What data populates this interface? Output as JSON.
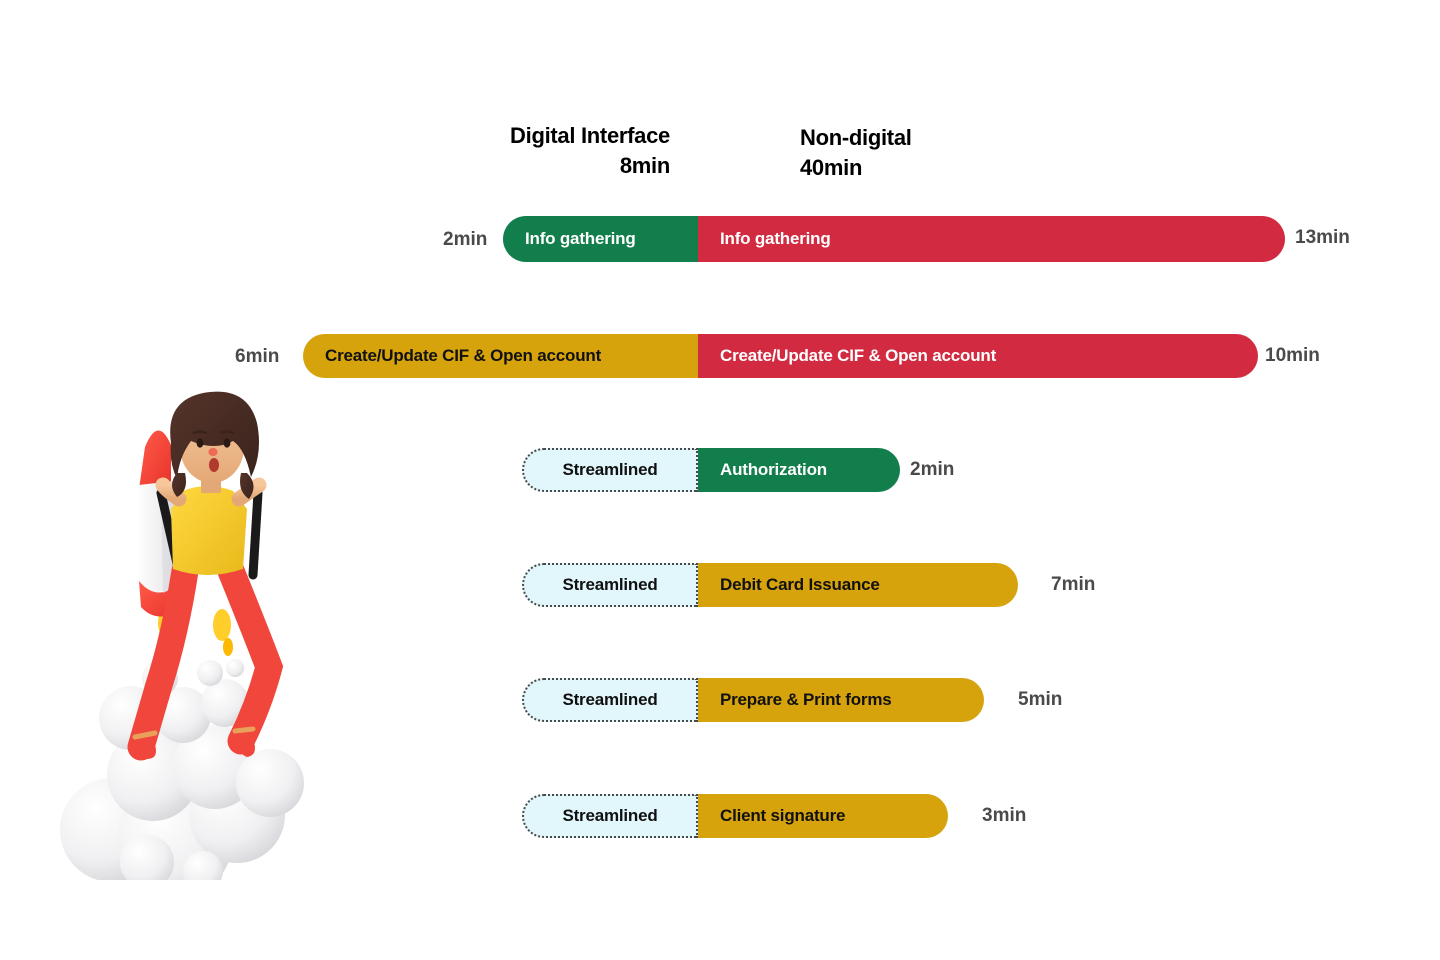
{
  "headers": {
    "digital": "Digital Interface\n8min",
    "non_digital": "Non-digital\n40min"
  },
  "colors": {
    "green": "#117E4B",
    "red": "#D22B41",
    "gold": "#D6A30D",
    "streamlined_bg": "#E2F7FB",
    "label_text": "#4a4a4a",
    "background": "#FFFFFF"
  },
  "rows": [
    {
      "id": "info-gathering",
      "left_label": "2min",
      "right_label": "13min",
      "digital_label": "Info gathering",
      "nondigital_label": "Info gathering",
      "digital_minutes": 2,
      "nondigital_minutes": 13
    },
    {
      "id": "create-update-cif",
      "left_label": "6min",
      "right_label": "10min",
      "digital_label": "Create/Update CIF & Open account",
      "nondigital_label": "Create/Update CIF & Open account",
      "digital_minutes": 6,
      "nondigital_minutes": 10
    },
    {
      "id": "authorization",
      "pill_label": "Streamlined",
      "task_label": "Authorization",
      "right_label": "2min",
      "nondigital_minutes": 2
    },
    {
      "id": "debit-card-issuance",
      "pill_label": "Streamlined",
      "task_label": "Debit Card Issuance",
      "right_label": "7min",
      "nondigital_minutes": 7
    },
    {
      "id": "prepare-print-forms",
      "pill_label": "Streamlined",
      "task_label": "Prepare & Print forms",
      "right_label": "5min",
      "nondigital_minutes": 5
    },
    {
      "id": "client-signature",
      "pill_label": "Streamlined",
      "task_label": "Client signature",
      "right_label": "3min",
      "nondigital_minutes": 3
    }
  ],
  "illustration": {
    "name": "woman-riding-rocket-illustration"
  },
  "chart_data": {
    "type": "bar",
    "title": "",
    "subtitle": "",
    "xlabel": "",
    "ylabel": "",
    "orientation": "horizontal",
    "stacked": true,
    "categories": [
      "Info gathering",
      "Create/Update CIF & Open account",
      "Authorization",
      "Debit Card Issuance",
      "Prepare & Print forms",
      "Client signature"
    ],
    "series": [
      {
        "name": "Digital Interface",
        "total": 8,
        "unit": "min",
        "color": "#117E4B",
        "values": [
          2,
          6,
          null,
          null,
          null,
          null
        ]
      },
      {
        "name": "Non-digital",
        "total": 40,
        "unit": "min",
        "color": "#D22B41",
        "values": [
          13,
          10,
          2,
          7,
          5,
          3
        ]
      }
    ],
    "legend": [
      "Digital Interface 8min",
      "Non-digital 40min"
    ],
    "annotations": [
      "Streamlined",
      "Streamlined",
      "Streamlined",
      "Streamlined"
    ],
    "grid": false
  }
}
